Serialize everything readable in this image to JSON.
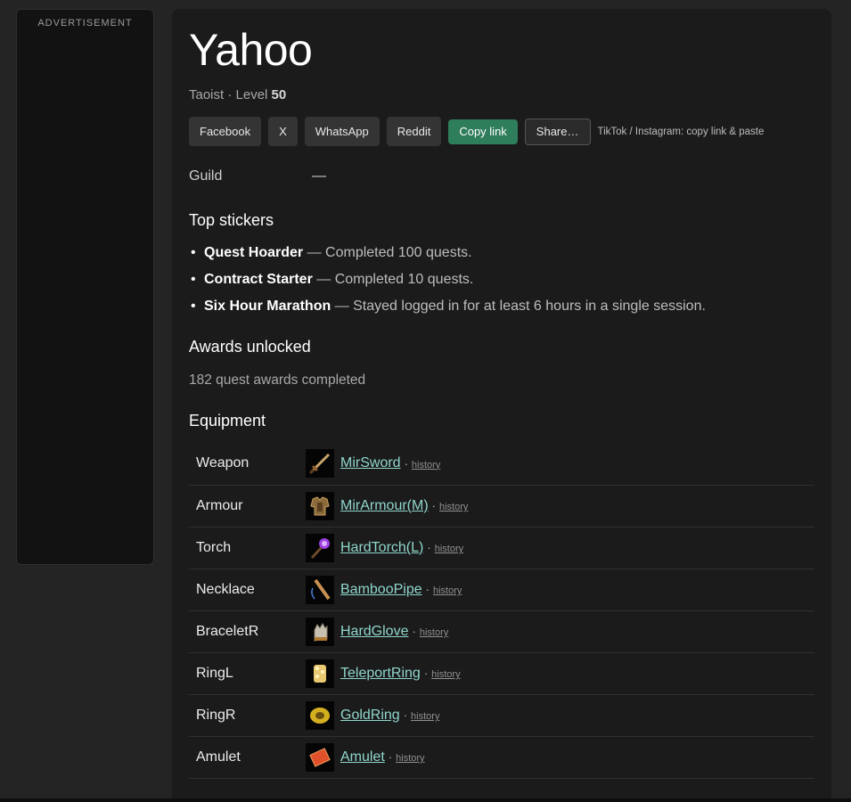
{
  "ad": {
    "label": "ADVERTISEMENT"
  },
  "profile": {
    "name": "Yahoo",
    "class_label": "Taoist · Level ",
    "level": "50"
  },
  "share": {
    "buttons": [
      "Facebook",
      "X",
      "WhatsApp",
      "Reddit"
    ],
    "copy_link": "Copy link",
    "share_more": "Share…",
    "note": "TikTok / Instagram: copy link & paste"
  },
  "guild": {
    "label": "Guild",
    "value": "—"
  },
  "stickers": {
    "heading": "Top stickers",
    "items": [
      {
        "name": "Quest Hoarder",
        "desc": " — Completed 100 quests."
      },
      {
        "name": "Contract Starter",
        "desc": " — Completed 10 quests."
      },
      {
        "name": "Six Hour Marathon",
        "desc": " — Stayed logged in for at least 6 hours in a single session."
      }
    ]
  },
  "awards": {
    "heading": "Awards unlocked",
    "text": "182 quest awards completed"
  },
  "equipment": {
    "heading": "Equipment",
    "history_label": "history",
    "separator": "·",
    "rows": [
      {
        "slot": "Weapon",
        "item": "MirSword",
        "icon": "sword-icon"
      },
      {
        "slot": "Armour",
        "item": "MirArmour(M)",
        "icon": "armour-icon"
      },
      {
        "slot": "Torch",
        "item": "HardTorch(L)",
        "icon": "torch-icon"
      },
      {
        "slot": "Necklace",
        "item": "BambooPipe",
        "icon": "bamboo-pipe-icon"
      },
      {
        "slot": "BraceletR",
        "item": "HardGlove",
        "icon": "glove-icon"
      },
      {
        "slot": "RingL",
        "item": "TeleportRing",
        "icon": "teleport-ring-icon"
      },
      {
        "slot": "RingR",
        "item": "GoldRing",
        "icon": "gold-ring-icon"
      },
      {
        "slot": "Amulet",
        "item": "Amulet",
        "icon": "amulet-icon"
      }
    ]
  }
}
